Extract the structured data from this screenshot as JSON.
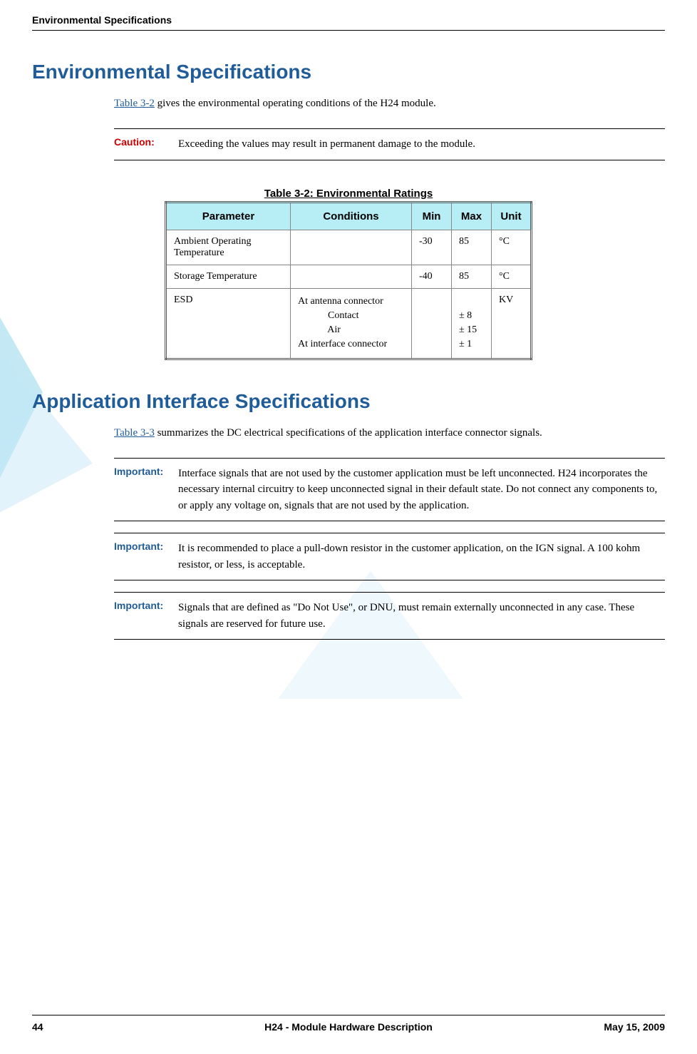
{
  "running_header": "Environmental Specifications",
  "section1": {
    "heading": "Environmental Specifications",
    "intro_prefix": "Table 3-2",
    "intro_suffix": " gives the environmental operating conditions of the H24 module.",
    "caution_label": "Caution:",
    "caution_text": "Exceeding the values may result in permanent damage to the module."
  },
  "table": {
    "title": "Table 3-2: Environmental Ratings",
    "headers": {
      "param": "Parameter",
      "cond": "Conditions",
      "min": "Min",
      "max": "Max",
      "unit": "Unit"
    },
    "rows": [
      {
        "param": "Ambient Operating Temperature",
        "cond": "",
        "min": "-30",
        "max": "85",
        "unit": "°C"
      },
      {
        "param": "Storage Temperature",
        "cond": "",
        "min": "-40",
        "max": "85",
        "unit": "°C"
      },
      {
        "param": "ESD",
        "cond": "At antenna connector\n            Contact\n            Air\nAt interface connector",
        "min": "",
        "max": "\n± 8\n± 15\n± 1",
        "unit": "KV"
      }
    ]
  },
  "section2": {
    "heading": "Application Interface Specifications",
    "intro_prefix": "Table 3-3",
    "intro_suffix": " summarizes the DC electrical specifications of the application interface connector signals.",
    "important_label": "Important:",
    "note1": "Interface signals that are not used by the customer application must be left unconnected. H24 incorporates the necessary internal circuitry to keep unconnected signal in their default state. Do not connect any components to, or apply any voltage on, signals that are not used by the application.",
    "note2": "It is recommended to place a pull-down resistor in the customer application, on the IGN signal. A 100 kohm resistor, or less, is acceptable.",
    "note3": "Signals that are defined as \"Do Not Use\", or DNU, must remain externally unconnected in any case. These signals are reserved for future use."
  },
  "footer": {
    "page": "44",
    "title": "H24 - Module Hardware Description",
    "date": "May 15, 2009"
  }
}
